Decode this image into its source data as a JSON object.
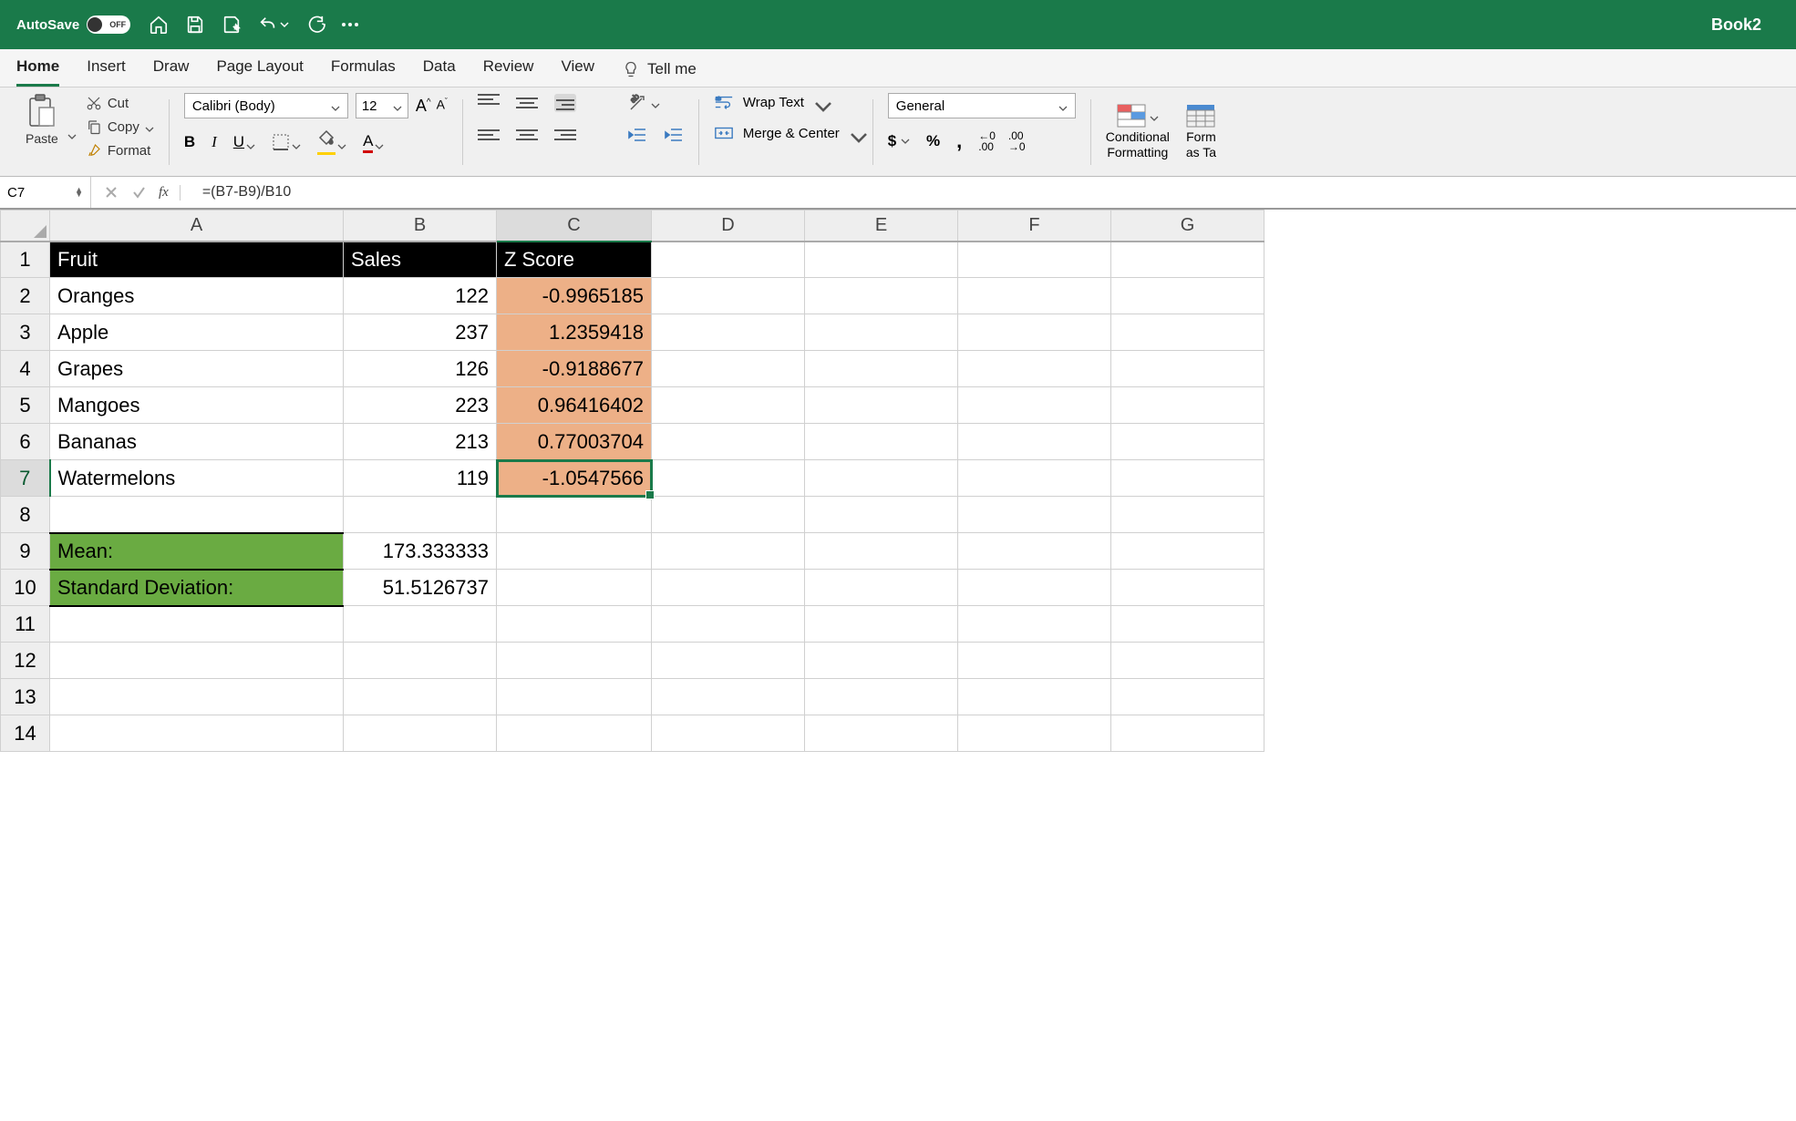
{
  "titlebar": {
    "autosave_label": "AutoSave",
    "autosave_state": "OFF",
    "book_title": "Book2"
  },
  "tabs": {
    "home": "Home",
    "insert": "Insert",
    "draw": "Draw",
    "page_layout": "Page Layout",
    "formulas": "Formulas",
    "data": "Data",
    "review": "Review",
    "view": "View",
    "tell_me": "Tell me"
  },
  "ribbon": {
    "paste": "Paste",
    "cut": "Cut",
    "copy": "Copy",
    "format": "Format",
    "font_name": "Calibri (Body)",
    "font_size": "12",
    "wrap_text": "Wrap Text",
    "merge_center": "Merge & Center",
    "number_format": "General",
    "conditional": "Conditional\nFormatting",
    "format_as_table": "Form\nas Ta"
  },
  "formula_bar": {
    "cell_ref": "C7",
    "formula": "=(B7-B9)/B10"
  },
  "columns": [
    "A",
    "B",
    "C",
    "D",
    "E",
    "F",
    "G"
  ],
  "rows": [
    "1",
    "2",
    "3",
    "4",
    "5",
    "6",
    "7",
    "8",
    "9",
    "10",
    "11",
    "12",
    "13",
    "14"
  ],
  "sheet": {
    "headers": {
      "A1": "Fruit",
      "B1": "Sales",
      "C1": "Z Score"
    },
    "data": [
      {
        "fruit": "Oranges",
        "sales": "122",
        "z": "-0.9965185"
      },
      {
        "fruit": "Apple",
        "sales": "237",
        "z": "1.2359418"
      },
      {
        "fruit": "Grapes",
        "sales": "126",
        "z": "-0.9188677"
      },
      {
        "fruit": "Mangoes",
        "sales": "223",
        "z": "0.96416402"
      },
      {
        "fruit": "Bananas",
        "sales": "213",
        "z": "0.77003704"
      },
      {
        "fruit": "Watermelons",
        "sales": "119",
        "z": "-1.0547566"
      }
    ],
    "mean_label": "Mean:",
    "mean_value": "173.333333",
    "std_label": "Standard Deviation:",
    "std_value": "51.5126737"
  }
}
